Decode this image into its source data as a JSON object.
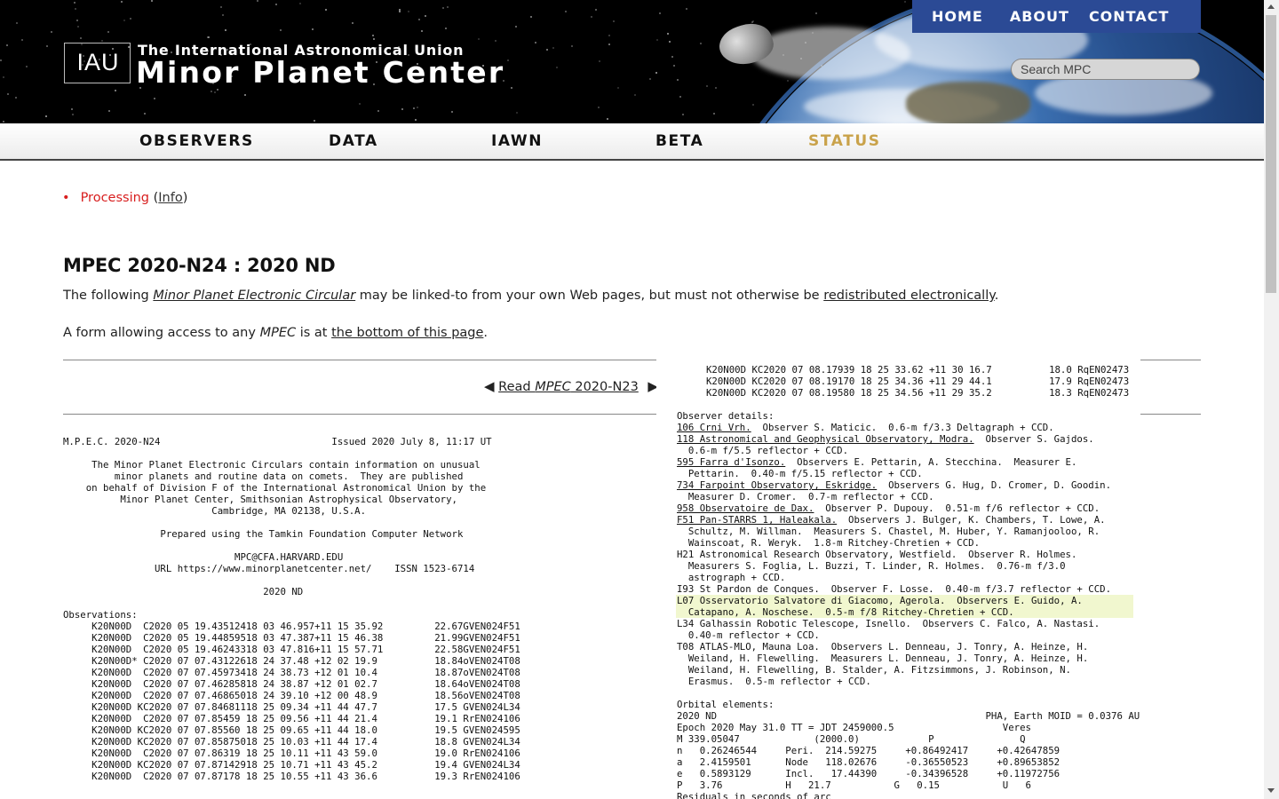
{
  "header": {
    "logo_mark": "IAU",
    "logo_subtitle": "The International Astronomical Union",
    "logo_title": "Minor Planet Center",
    "top_nav": [
      "HOME",
      "ABOUT",
      "CONTACT"
    ],
    "search_placeholder": "Search MPC",
    "accent_color": "#2b4a95"
  },
  "section_nav": {
    "items": [
      "OBSERVERS",
      "DATA",
      "IAWN",
      "BETA",
      "STATUS"
    ],
    "active": "STATUS",
    "active_color": "#c9a24a"
  },
  "status": {
    "bullet": "•",
    "text": "Processing",
    "info_prefix": " (",
    "info_label": "Info",
    "info_suffix": ")",
    "color": "#d81e1e"
  },
  "page": {
    "title": "MPEC 2020-N24 : 2020 ND",
    "para1_pre": "The following ",
    "para1_link": "Minor Planet Electronic Circular",
    "para1_mid": " may be linked-to from your own Web pages, but must not otherwise be ",
    "para1_link2": "redistributed electronically",
    "para1_post": ".",
    "para2_pre": "A form allowing access to any ",
    "para2_em": "MPEC",
    "para2_mid": " is at ",
    "para2_link": "the bottom of this page",
    "para2_post": ".",
    "prev_read": "Read ",
    "prev_em": "MPEC",
    "prev_num": " 2020-N23"
  },
  "circular": {
    "left_text": "M.P.E.C. 2020-N24                              Issued 2020 July 8, 11:17 UT\n\n     The Minor Planet Electronic Circulars contain information on unusual\n         minor planets and routine data on comets.  They are published\n    on behalf of Division F of the International Astronomical Union by the\n          Minor Planet Center, Smithsonian Astrophysical Observatory,\n                          Cambridge, MA 02138, U.S.A.\n\n                 Prepared using the Tamkin Foundation Computer Network\n\n                              MPC@CFA.HARVARD.EDU\n                URL https://www.minorplanetcenter.net/    ISSN 1523-6714\n\n                                   2020 ND\n\nObservations:\n     K20N00D  C2020 05 19.43512418 03 46.957+11 15 35.92         22.67GVEN024F51\n     K20N00D  C2020 05 19.44859518 03 47.387+11 15 46.38         21.99GVEN024F51\n     K20N00D  C2020 05 19.46243318 03 47.816+11 15 57.71         22.58GVEN024F51\n     K20N00D* C2020 07 07.43122618 24 37.48 +12 02 19.9          18.84oVEN024T08\n     K20N00D  C2020 07 07.45973418 24 38.73 +12 01 10.4          18.87oVEN024T08\n     K20N00D  C2020 07 07.46285818 24 38.87 +12 01 02.7          18.64oVEN024T08\n     K20N00D  C2020 07 07.46865018 24 39.10 +12 00 48.9          18.56oVEN024T08\n     K20N00D KC2020 07 07.84681118 25 09.34 +11 44 47.7          17.5 GVEN024L34\n     K20N00D  C2020 07 07.85459 18 25 09.56 +11 44 21.4          19.1 RrEN024106\n     K20N00D KC2020 07 07.85560 18 25 09.65 +11 44 18.0          19.5 GVEN024595\n     K20N00D KC2020 07 07.85875018 25 10.03 +11 44 17.4          18.8 GVEN024L34\n     K20N00D  C2020 07 07.86319 18 25 10.11 +11 43 59.0          19.0 RrEN024106\n     K20N00D KC2020 07 07.87142918 25 10.71 +11 43 45.2          19.4 GVEN024L34\n     K20N00D  C2020 07 07.87178 18 25 10.55 +11 43 36.6          19.3 RrEN024106",
    "right_obs": "K20N00D KC2020 07 08.17939 18 25 33.62 +11 30 16.7          18.0 RqEN02473\nK20N00D KC2020 07 08.19170 18 25 34.36 +11 29 44.1          17.9 RqEN02473\nK20N00D KC2020 07 08.19580 18 25 34.56 +11 29 35.2          18.3 RqEN02473",
    "observer_details": [
      {
        "code": "Observer details:",
        "link": false,
        "text": ""
      },
      {
        "code": "106 Crni Vrh.",
        "link": true,
        "text": "  Observer S. Maticic.  0.6-m f/3.3 Deltagraph + CCD."
      },
      {
        "code": "118 Astronomical and Geophysical Observatory, Modra.",
        "link": true,
        "text": "  Observer S. Gajdos.\n  0.6-m f/5.5 reflector + CCD."
      },
      {
        "code": "595 Farra d'Isonzo.",
        "link": true,
        "text": "  Observers E. Pettarin, A. Stecchina.  Measurer E.\n  Pettarin.  0.40-m f/5.15 reflector + CCD."
      },
      {
        "code": "734 Farpoint Observatory, Eskridge.",
        "link": true,
        "text": "  Observers G. Hug, D. Cromer, D. Goodin.\n  Measurer D. Cromer.  0.7-m reflector + CCD."
      },
      {
        "code": "958 Observatoire de Dax.",
        "link": true,
        "text": "  Observer P. Dupouy.  0.51-m f/6 reflector + CCD."
      },
      {
        "code": "F51 Pan-STARRS 1, Haleakala.",
        "link": true,
        "text": "  Observers J. Bulger, K. Chambers, T. Lowe, A.\n  Schultz, M. Willman.  Measurers S. Chastel, M. Huber, Y. Ramanjooloo, R.\n  Wainscoat, R. Weryk.  1.8-m Ritchey-Chretien + CCD."
      },
      {
        "code": "H21 Astronomical Research Observatory, Westfield.",
        "link": false,
        "text": "  Observer R. Holmes.\n  Measurers S. Foglia, L. Buzzi, T. Linder, R. Holmes.  0.76-m f/3.0\n  astrograph + CCD."
      },
      {
        "code": "I93 St Pardon de Conques.",
        "link": false,
        "text": "  Observer F. Losse.  0.40-m f/3.7 reflector + CCD."
      },
      {
        "code": "L07 Osservatorio Salvatore di Giacomo, Agerola.",
        "link": false,
        "text": "  Observers E. Guido, A.\n  Catapano, A. Noschese.  0.5-m f/8 Ritchey-Chretien + CCD."
      },
      {
        "code": "L34 Galhassin Robotic Telescope, Isnello.",
        "link": false,
        "text": "  Observers C. Falco, A. Nastasi.\n  0.40-m reflector + CCD."
      },
      {
        "code": "T08 ATLAS-MLO, Mauna Loa.",
        "link": false,
        "text": "  Observers L. Denneau, J. Tonry, A. Heinze, H.\n  Weiland, H. Flewelling.  Measurers L. Denneau, J. Tonry, A. Heinze, H.\n  Weiland, H. Flewelling, B. Stalder, A. Fitzsimmons, J. Robinson, N.\n  Erasmus.  0.5-m reflector + CCD."
      }
    ],
    "orbital_text": "Orbital elements:\n2020 ND                                               PHA, Earth MOID = 0.0376 AU\nEpoch 2020 May 31.0 TT = JDT 2459000.5                   Veres\nM 339.05047             (2000.0)            P               Q\nn   0.26246544     Peri.  214.59275     +0.86492417     +0.42647859\na   2.4159501      Node   118.02676     -0.36550523     +0.89653852\ne   0.5893129      Incl.   17.44390     -0.34396528     +0.11972756\nP   3.76           H   21.7           G   0.15           U   6\nResiduals in seconds of arc"
  }
}
